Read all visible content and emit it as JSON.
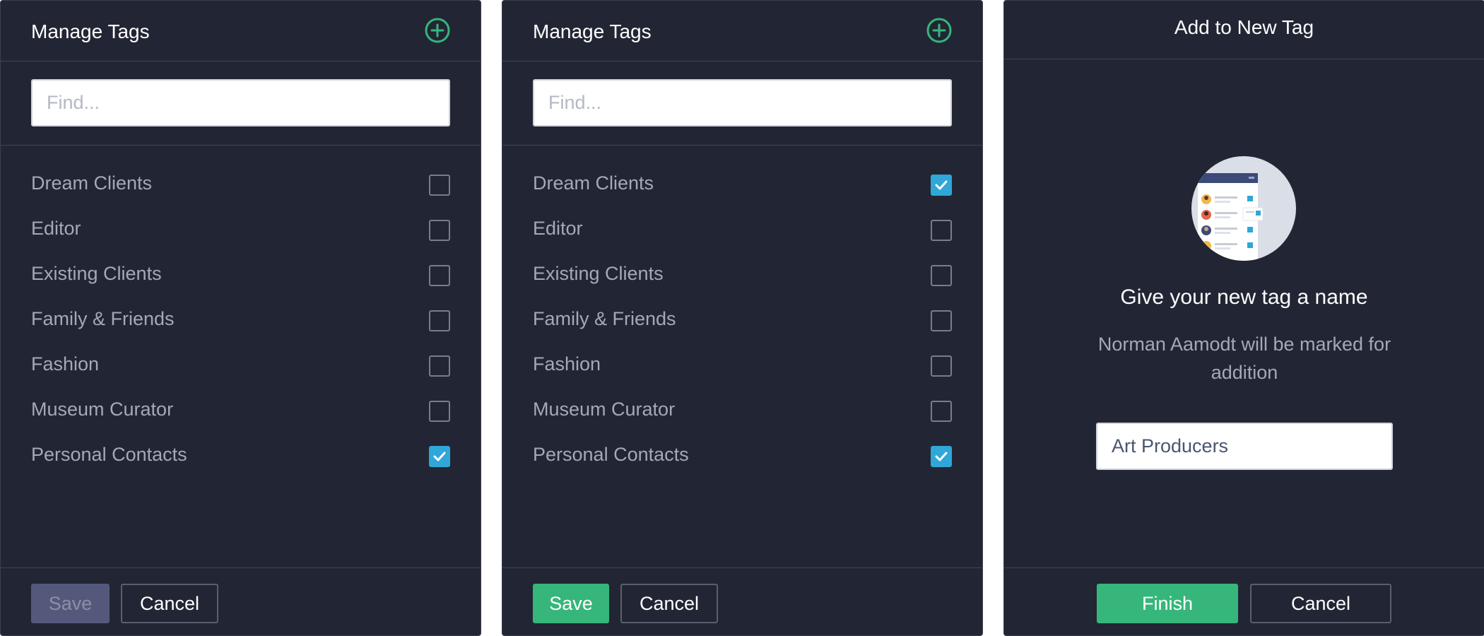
{
  "panel1": {
    "title": "Manage Tags",
    "search_placeholder": "Find...",
    "tags": [
      {
        "label": "Dream Clients",
        "checked": false
      },
      {
        "label": "Editor",
        "checked": false
      },
      {
        "label": "Existing Clients",
        "checked": false
      },
      {
        "label": "Family & Friends",
        "checked": false
      },
      {
        "label": "Fashion",
        "checked": false
      },
      {
        "label": "Museum Curator",
        "checked": false
      },
      {
        "label": "Personal Contacts",
        "checked": true
      }
    ],
    "save_label": "Save",
    "save_state": "disabled",
    "cancel_label": "Cancel"
  },
  "panel2": {
    "title": "Manage Tags",
    "search_placeholder": "Find...",
    "tags": [
      {
        "label": "Dream Clients",
        "checked": true
      },
      {
        "label": "Editor",
        "checked": false
      },
      {
        "label": "Existing Clients",
        "checked": false
      },
      {
        "label": "Family & Friends",
        "checked": false
      },
      {
        "label": "Fashion",
        "checked": false
      },
      {
        "label": "Museum Curator",
        "checked": false
      },
      {
        "label": "Personal Contacts",
        "checked": true
      }
    ],
    "save_label": "Save",
    "save_state": "enabled",
    "cancel_label": "Cancel"
  },
  "panel3": {
    "title": "Add to New Tag",
    "illustration_icon": "tag-list-illustration",
    "prompt": "Give your new tag a name",
    "description": "Norman Aamodt will be marked for addition",
    "input_value": "Art Producers",
    "finish_label": "Finish",
    "cancel_label": "Cancel"
  },
  "icons": {
    "add": "plus-circle-icon",
    "check": "checkmark-icon"
  },
  "colors": {
    "panel_bg": "#222634",
    "accent_green": "#36b67a",
    "checkbox_blue": "#2fa7d8",
    "disabled_button": "#54597c",
    "text_muted": "#a4a9b6"
  }
}
